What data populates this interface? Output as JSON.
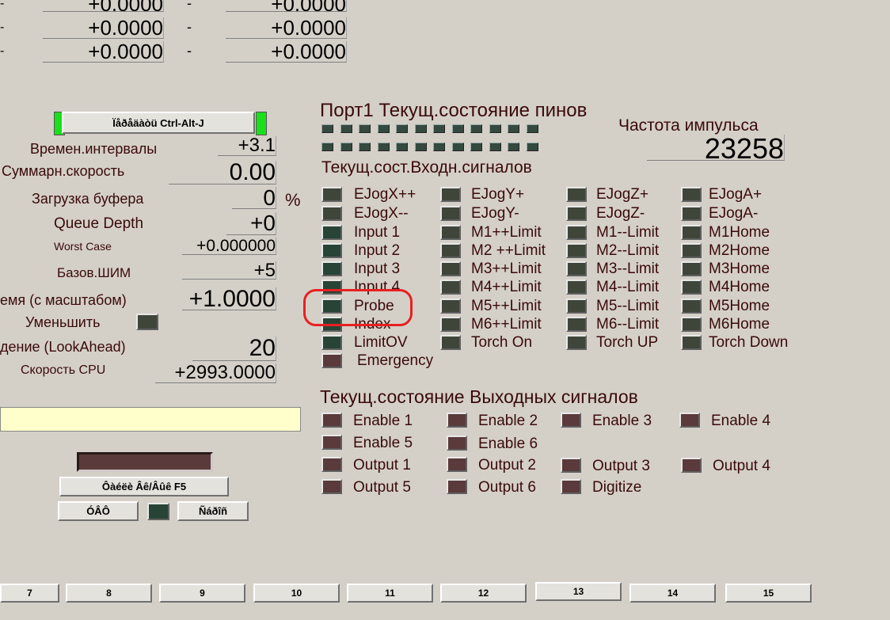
{
  "top_readouts": {
    "rows": [
      {
        "left": "+0.0000",
        "dash": "-",
        "right": "+0.0000"
      },
      {
        "left": "+0.0000",
        "dash": "-",
        "right": "+0.0000"
      },
      {
        "left": "+0.0000",
        "dash": "-",
        "right": "+0.0000"
      }
    ]
  },
  "left_panel": {
    "reset_button": "Ïåðåäàòü Ctrl-Alt-J",
    "time_intervals": {
      "label": "Времен.интервалы",
      "value": "+3.1"
    },
    "total_speed": {
      "label": "Суммарн.скорость",
      "value": "0.00"
    },
    "buffer_load": {
      "label": "Загрузка буфера",
      "value": "0",
      "unit": "%"
    },
    "queue_depth": {
      "label": "Queue Depth",
      "value": "+0"
    },
    "worst_case": {
      "label": "Worst Case",
      "value": "+0.000000"
    },
    "base_pwm": {
      "label": "Базов.ШИМ",
      "value": "+5"
    },
    "time_scale": {
      "label": "емя (с масштабом)",
      "value": "+1.0000"
    },
    "reduce": {
      "label": "Уменьшить"
    },
    "lookahead": {
      "label": "дение (LookAhead)",
      "value": "20"
    },
    "cpu_speed": {
      "label": "Скорость CPU",
      "value": "+2993.0000"
    },
    "btn_f5": "Ôàéëè Âê/Âûê F5",
    "btn_left": "ÓÂÔ",
    "btn_right": "Ñáðîñ"
  },
  "port_pins": {
    "title": "Порт1 Текущ.состояние пинов"
  },
  "pulse_freq": {
    "label": "Частота импульса",
    "value": "23258"
  },
  "inputs": {
    "title": "Текущ.сост.Входн.сигналов",
    "col1": [
      "EJogX++",
      "EJogX--",
      "Input 1",
      "Input 2",
      "Input 3",
      "Input 4",
      "Probe",
      "Index",
      "LimitOV",
      "Emergency"
    ],
    "col2": [
      "EJogY+",
      "EJogY-",
      "M1++Limit",
      "M2 ++Limit",
      "M3++Limit",
      "M4++Limit",
      "M5++Limit",
      "M6++Limit",
      "Torch On"
    ],
    "col3": [
      "EJogZ+",
      "EJogZ-",
      "M1--Limit",
      "M2--Limit",
      "M3--Limit",
      "M4--Limit",
      "M5--Limit",
      "M6--Limit",
      "Torch UP"
    ],
    "col4": [
      "EJogA+",
      "EJogA-",
      "M1Home",
      "M2Home",
      "M3Home",
      "M4Home",
      "M5Home",
      "M6Home",
      "Torch Down"
    ]
  },
  "outputs": {
    "title": "Текущ.состояние Выходных сигналов",
    "items": [
      "Enable 1",
      "Enable 2",
      "Enable 3",
      "Enable 4",
      "Enable 5",
      "Enable 6",
      "Output 1",
      "Output 2",
      "Output 3",
      "Output 4",
      "Output 5",
      "Output 6",
      "Digitize"
    ]
  },
  "bottom_tabs": [
    "7",
    "8",
    "9",
    "10",
    "11",
    "12",
    "13",
    "14",
    "15"
  ],
  "colors": {
    "label": "#3a0a0a",
    "background": "#d4d0c8",
    "led_green": "#274436",
    "led_red": "#5a3a3a",
    "highlight": "#e82020",
    "yellow_field": "#ffffcc"
  }
}
